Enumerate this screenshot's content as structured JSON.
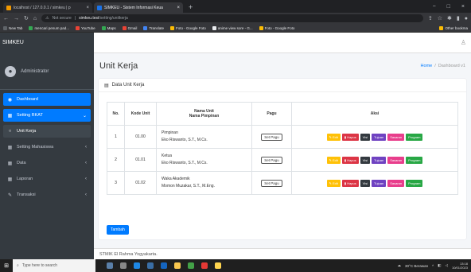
{
  "browser": {
    "tabs": [
      {
        "label": "localhost / 127.0.0.1 / simkeu | p",
        "active": false,
        "icon_color": "#f29900"
      },
      {
        "label": "SIMKEU - Sistem Informasi Keua",
        "active": true,
        "icon_color": "#1a73e8"
      }
    ],
    "new_tab": "+",
    "security_label": "Not secure",
    "url_host": "simkeu.test",
    "url_path": "/setting/unitkerja",
    "bookmarks": [
      {
        "label": "New Tab",
        "color": "#5f6368"
      },
      {
        "label": "mencari penum pad...",
        "color": "#34a853"
      },
      {
        "label": "YouTube",
        "color": "#ea4335"
      },
      {
        "label": "Maps",
        "color": "#34a853"
      },
      {
        "label": "Gmail",
        "color": "#ea4335"
      },
      {
        "label": "Translate",
        "color": "#4285f4"
      },
      {
        "label": "Foto - Google Foto",
        "color": "#fbbc04"
      },
      {
        "label": "anime view sore - G...",
        "color": "#e8eaed"
      },
      {
        "label": "Foto - Google Foto",
        "color": "#fbbc04"
      }
    ],
    "other_bookmarks": "Other bookma"
  },
  "app": {
    "brand": "SIMKEU",
    "user": "Administrator",
    "menu": [
      {
        "label": "Dashboard",
        "icon": "dashboard-icon",
        "glyph": "◉",
        "state": "active",
        "arrow": ""
      },
      {
        "label": "Setting RKAT",
        "icon": "grid-icon",
        "glyph": "▦",
        "state": "active",
        "arrow": "⌄"
      },
      {
        "label": "Unit Kerja",
        "icon": "circle-icon",
        "glyph": "○",
        "state": "parent",
        "arrow": ""
      },
      {
        "label": "Setting Mahasiswa",
        "icon": "grid-icon",
        "glyph": "▦",
        "state": "",
        "arrow": "‹"
      },
      {
        "label": "Data",
        "icon": "grid-icon",
        "glyph": "▦",
        "state": "",
        "arrow": "‹"
      },
      {
        "label": "Laporan",
        "icon": "grid-icon",
        "glyph": "▦",
        "state": "",
        "arrow": "‹"
      },
      {
        "label": "Transaksi",
        "icon": "edit-icon",
        "glyph": "✎",
        "state": "",
        "arrow": "‹"
      }
    ],
    "page_title": "Unit Kerja",
    "breadcrumb": {
      "home": "Home",
      "sep": "/",
      "current": "Dashboard v1"
    },
    "card_title": "Data Unit Kerja",
    "table": {
      "headers": {
        "no": "No.",
        "kode": "Kode Unit",
        "nama": "Nama Unit",
        "pimpinan": "Nama Pimpinan",
        "pagu": "Pagu",
        "aksi": "Aksi"
      },
      "rows": [
        {
          "no": "1",
          "kode": "01.00",
          "unit": "Pimpinan",
          "pimpinan": "Eko Riswanto, S.T., M.Cs.",
          "pagu": "Set Pagu"
        },
        {
          "no": "2",
          "kode": "01.01",
          "unit": "Ketua",
          "pimpinan": "Eko Riswanto, S.T., M.Cs.",
          "pagu": "Set Pagu"
        },
        {
          "no": "3",
          "kode": "01.02",
          "unit": "Waka Akademik",
          "pimpinan": "Momon Muzakar, S.T., M.Eng.",
          "pagu": "Set Pagu"
        }
      ],
      "actions": {
        "edit": "Edit",
        "hapus": "Hapus",
        "visi": "Visi",
        "tujuan": "Tujuan",
        "sasaran": "Sasaran",
        "program": "Program"
      }
    },
    "tambah": "Tambah",
    "footer": "STMIK El Rahma Yogyakarta."
  },
  "taskbar": {
    "search_placeholder": "Type here to search",
    "weather": "30°C Berawan",
    "time": "13:18",
    "date": "10/01/2023"
  }
}
